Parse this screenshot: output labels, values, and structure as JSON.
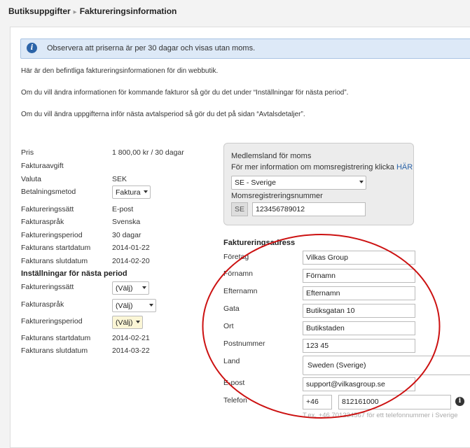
{
  "breadcrumb": {
    "root": "Butiksuppgifter",
    "separator": "▸",
    "current": "Faktureringsinformation"
  },
  "notice": {
    "icon": "info-icon",
    "text": "Observera att priserna är per 30 dagar och visas utan moms."
  },
  "paragraphs": [
    "Här är den befintliga faktureringsinformationen för din webbutik.",
    "Om du vill ändra informationen för kommande fakturor så gör du det under “Inställningar för nästa period”.",
    "Om du vill ändra uppgifterna inför nästa avtalsperiod så gör du det på sidan “Avtalsdetaljer”."
  ],
  "billing": {
    "pris_label": "Pris",
    "pris_value": "1 800,00 kr / 30 dagar",
    "fakturaavgift_label": "Fakturaavgift",
    "valuta_label": "Valuta",
    "valuta_value": "SEK",
    "betalningsmetod_label": "Betalningsmetod",
    "betalningsmetod_value": "Faktura",
    "faktureringssatt_label": "Faktureringssätt",
    "faktureringssatt_value": "E-post",
    "fakturasprak_label": "Fakturaspråk",
    "fakturasprak_value": "Svenska",
    "faktureringsperiod_label": "Faktureringsperiod",
    "faktureringsperiod_value": "30 dagar",
    "startdatum_label": "Fakturans startdatum",
    "startdatum_value": "2014-01-22",
    "slutdatum_label": "Fakturans slutdatum",
    "slutdatum_value": "2014-02-20"
  },
  "next_period": {
    "title": "Inställningar för nästa period",
    "faktureringssatt_label": "Faktureringssätt",
    "faktureringssatt_value": "(Välj)",
    "fakturasprak_label": "Fakturaspråk",
    "fakturasprak_value": "(Välj)",
    "faktureringsperiod_label": "Faktureringsperiod",
    "faktureringsperiod_value": "(Välj)",
    "startdatum_label": "Fakturans startdatum",
    "startdatum_value": "2014-02-21",
    "slutdatum_label": "Fakturans slutdatum",
    "slutdatum_value": "2014-03-22"
  },
  "moms": {
    "title": "Medlemsland för moms",
    "info_text": "För mer information om momsregistrering klicka",
    "info_link": "HÄR",
    "country": "SE - Sverige",
    "regnr_label": "Momsregistreringsnummer",
    "regnr_prefix": "SE",
    "regnr_value": "123456789012"
  },
  "address": {
    "title": "Faktureringsadress",
    "foretag_label": "Företag",
    "foretag_value": "Vilkas Group",
    "fornamn_label": "Förnamn",
    "fornamn_value": "Förnamn",
    "efternamn_label": "Efternamn",
    "efternamn_value": "Efternamn",
    "gata_label": "Gata",
    "gata_value": "Butiksgatan 10",
    "ort_label": "Ort",
    "ort_value": "Butikstaden",
    "postnummer_label": "Postnummer",
    "postnummer_value": "123 45",
    "land_label": "Land",
    "land_value": "Sweden (Sverige)",
    "epost_label": "E-post",
    "epost_value": "support@vilkasgroup.se",
    "telefon_label": "Telefon",
    "telefon_prefix": "+46",
    "telefon_value": "812161000",
    "telefon_hint": "T.ex. +46 701234567 för ett telefonnummer i Sverige"
  },
  "colors": {
    "annotation": "#cc1111",
    "link": "#2c64a8",
    "notice_bg": "#dde9f7"
  }
}
